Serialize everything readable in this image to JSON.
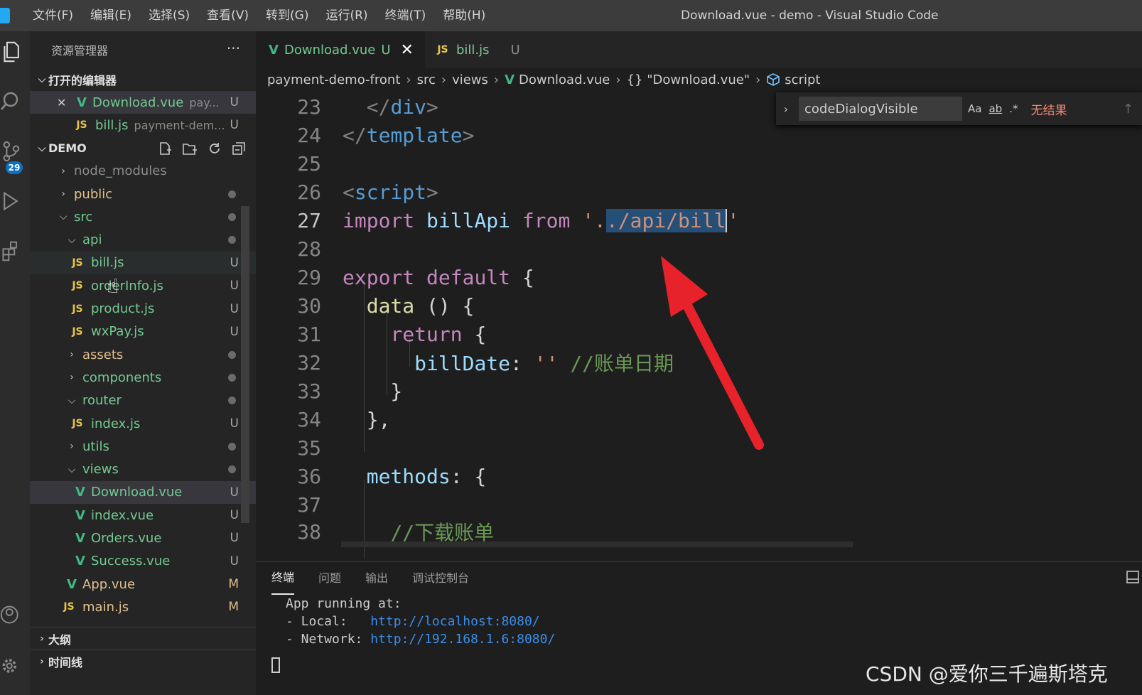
{
  "window": {
    "title": "Download.vue - demo - Visual Studio Code",
    "menu": [
      "文件(F)",
      "编辑(E)",
      "选择(S)",
      "查看(V)",
      "转到(G)",
      "运行(R)",
      "终端(T)",
      "帮助(H)"
    ]
  },
  "activity_bar": {
    "scm_badge": "29"
  },
  "sidebar": {
    "title": "资源管理器",
    "more": "···",
    "open_editors_label": "打开的编辑器",
    "open_editors": [
      {
        "name": "Download.vue",
        "desc": "pay...",
        "status": "U",
        "close": "✕"
      },
      {
        "name": "bill.js",
        "desc": "payment-dem...",
        "status": "U"
      }
    ],
    "folder_label": "DEMO",
    "tree": [
      {
        "name": "node_modules"
      },
      {
        "name": "public"
      },
      {
        "name": "src"
      },
      {
        "name": "api"
      },
      {
        "name": "bill.js",
        "status": "U"
      },
      {
        "name": "orderInfo.js",
        "status": "U"
      },
      {
        "name": "product.js",
        "status": "U"
      },
      {
        "name": "wxPay.js",
        "status": "U"
      },
      {
        "name": "assets"
      },
      {
        "name": "components"
      },
      {
        "name": "router"
      },
      {
        "name": "index.js",
        "status": "U"
      },
      {
        "name": "utils"
      },
      {
        "name": "views"
      },
      {
        "name": "Download.vue",
        "status": "U"
      },
      {
        "name": "index.vue",
        "status": "U"
      },
      {
        "name": "Orders.vue",
        "status": "U"
      },
      {
        "name": "Success.vue",
        "status": "U"
      },
      {
        "name": "App.vue",
        "status": "M"
      },
      {
        "name": "main.js",
        "status": "M"
      }
    ],
    "outline_label": "大纲",
    "timeline_label": "时间线"
  },
  "tabs": [
    {
      "label": "Download.vue",
      "status": "U",
      "close": "✕"
    },
    {
      "label": "bill.js",
      "status": "U"
    }
  ],
  "breadcrumb": [
    "payment-demo-front",
    "src",
    "views",
    "Download.vue",
    "{} \"Download.vue\"",
    "script"
  ],
  "find": {
    "query": "codeDialogVisible",
    "opt_case": "Aa",
    "opt_word": "ab",
    "opt_regex": ".*",
    "result": "无结果"
  },
  "code": {
    "line_numbers": [
      "23",
      "24",
      "25",
      "26",
      "27",
      "28",
      "29",
      "30",
      "31",
      "32",
      "33",
      "34",
      "35",
      "36",
      "37",
      "38"
    ],
    "l23_tag": "div",
    "l24_tag": "template",
    "l26_tag": "script",
    "l27_import": "import",
    "l27_name": "billApi",
    "l27_from": "from",
    "l27_str_pre": "'.",
    "l27_str_sel": "./api/bill",
    "l27_str_post": "'",
    "l29_export": "export",
    "l29_default": "default",
    "l30_fn": "data",
    "l31_return": "return",
    "l32_prop": "billDate",
    "l32_str": "''",
    "l32_comment": "//账单日期",
    "l36_prop": "methods",
    "l38_comment": "//下载账单"
  },
  "panel": {
    "tabs": [
      "终端",
      "问题",
      "输出",
      "调试控制台"
    ],
    "terminal": {
      "line1": "App running at:",
      "local_label": "- Local:   ",
      "local_url": "http://localhost:8080/",
      "network_label": "- Network: ",
      "network_url": "http://192.168.1.6:8080/"
    }
  },
  "watermark": "CSDN @爱你三千遍斯塔克",
  "colors": {
    "annotation_arrow": "#e8222a",
    "accent": "#0e70c0"
  }
}
